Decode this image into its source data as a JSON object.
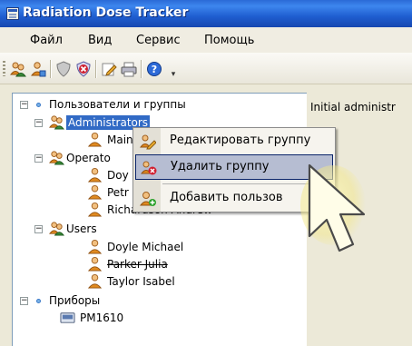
{
  "window": {
    "title": "Radiation Dose Tracker"
  },
  "menu": {
    "items": [
      "Файл",
      "Вид",
      "Сервис",
      "Помощь"
    ]
  },
  "toolbar": {
    "buttons": [
      "users-icon",
      "user-group-icon",
      "shield-icon",
      "shield-delete-icon",
      "edit-icon",
      "print-icon",
      "help-icon"
    ]
  },
  "tree": {
    "root_users": "Пользователи и группы",
    "group_admins": "Administrators",
    "admin_user": "Main",
    "group_operators": "Operato",
    "operator_1": "Doy",
    "operator_2": "Petr",
    "operator_3": "Richardson Andrew",
    "group_users": "Users",
    "user_1": "Doyle Michael",
    "user_2": "Parker Julia",
    "user_3": "Taylor Isabel",
    "root_devices": "Приборы",
    "device_1": "PM1610"
  },
  "right_panel": {
    "label": "Initial administr"
  },
  "context_menu": {
    "items": [
      "Редактировать группу",
      "Удалить группу",
      "Добавить пользов"
    ],
    "highlighted_index": 1
  },
  "colors": {
    "selection": "#316ac5",
    "titlebar": "#1f5ed0",
    "menu_hover": "#b6bdd2"
  }
}
